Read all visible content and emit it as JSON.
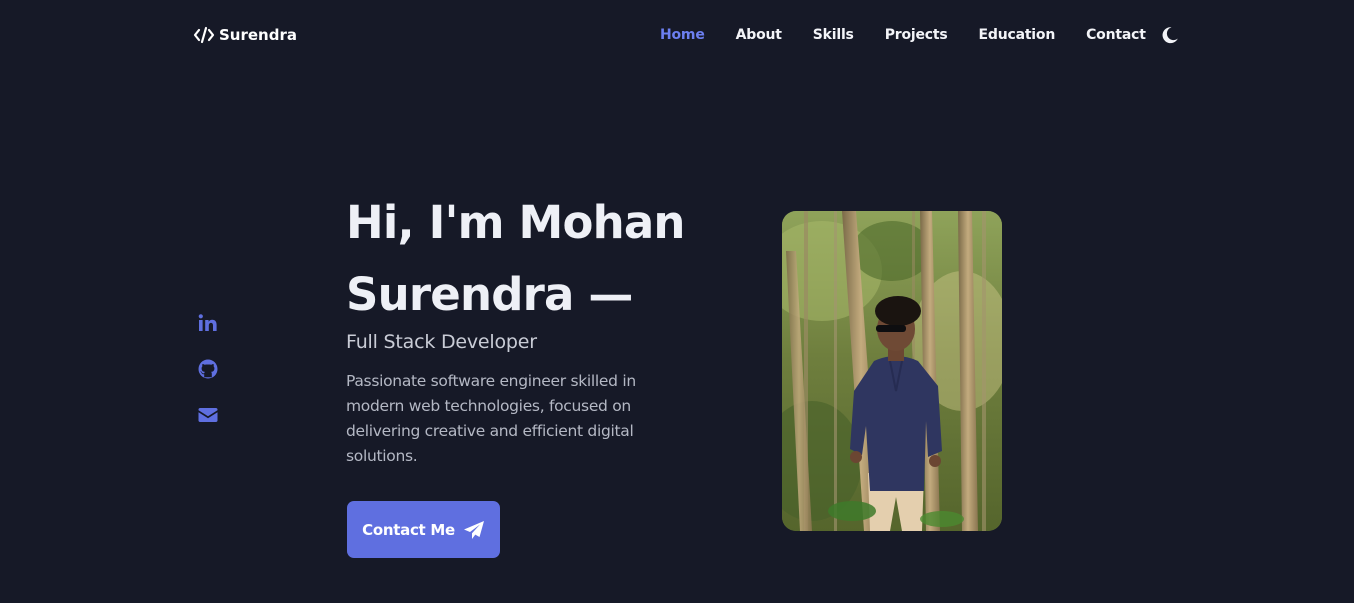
{
  "header": {
    "logo_text": "Surendra",
    "logo_icon": "code-icon",
    "nav": [
      {
        "label": "Home",
        "active": true
      },
      {
        "label": "About",
        "active": false
      },
      {
        "label": "Skills",
        "active": false
      },
      {
        "label": "Projects",
        "active": false
      },
      {
        "label": "Education",
        "active": false
      },
      {
        "label": "Contact",
        "active": false
      }
    ],
    "theme_toggle_icon": "moon-icon"
  },
  "socials": [
    {
      "icon": "linkedin-icon"
    },
    {
      "icon": "github-icon"
    },
    {
      "icon": "envelope-icon"
    }
  ],
  "hero": {
    "title_line1": "Hi, I'm Mohan",
    "title_line2": "Surendra —",
    "subtitle": "Full Stack Developer",
    "description": "Passionate software engineer skilled in modern web technologies, focused on delivering creative and efficient digital solutions.",
    "cta_label": "Contact Me",
    "cta_icon": "paper-plane-icon"
  },
  "colors": {
    "background": "#161927",
    "accent": "#5f6fe0",
    "nav_active": "#6c7ff0",
    "text_primary": "#eef0f6",
    "text_muted": "#b4b8c4"
  }
}
